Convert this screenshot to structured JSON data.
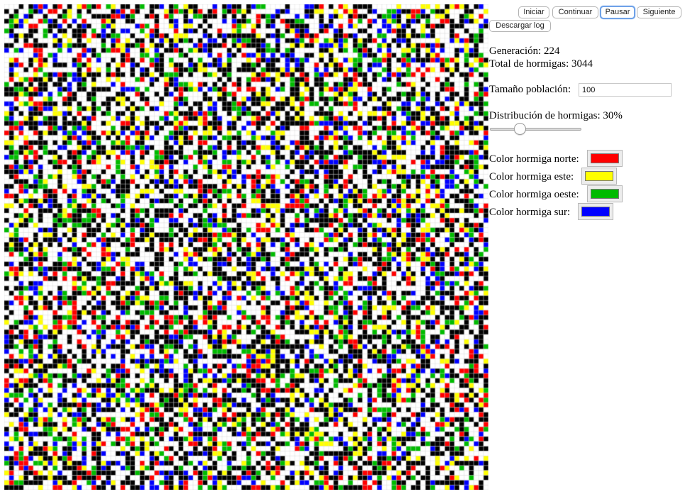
{
  "controls": {
    "start_label": "Iniciar",
    "continue_label": "Continuar",
    "pause_label": "Pausar",
    "next_label": "Siguiente",
    "download_label": "Descargar log"
  },
  "stats": {
    "generation_text": "Generación: 224",
    "total_ants_text": "Total de hormigas: 3044"
  },
  "population": {
    "label": "Tamaño población:",
    "value": "100"
  },
  "distribution": {
    "label": "Distribución de hormigas: 30%",
    "percent": 30
  },
  "ant_colors": [
    {
      "label": "Color hormiga norte:",
      "color": "#ff0000"
    },
    {
      "label": "Color hormiga este:",
      "color": "#ffff00"
    },
    {
      "label": "Color hormiga oeste:",
      "color": "#00bb00"
    },
    {
      "label": "Color hormiga sur:",
      "color": "#0000ff"
    }
  ],
  "grid": {
    "size": 100,
    "cell_colors": [
      "#ffffff",
      "#000000",
      "#ff0000",
      "#ffff00",
      "#00bb00",
      "#0000ff"
    ],
    "line_color": "#d0d0d0"
  }
}
